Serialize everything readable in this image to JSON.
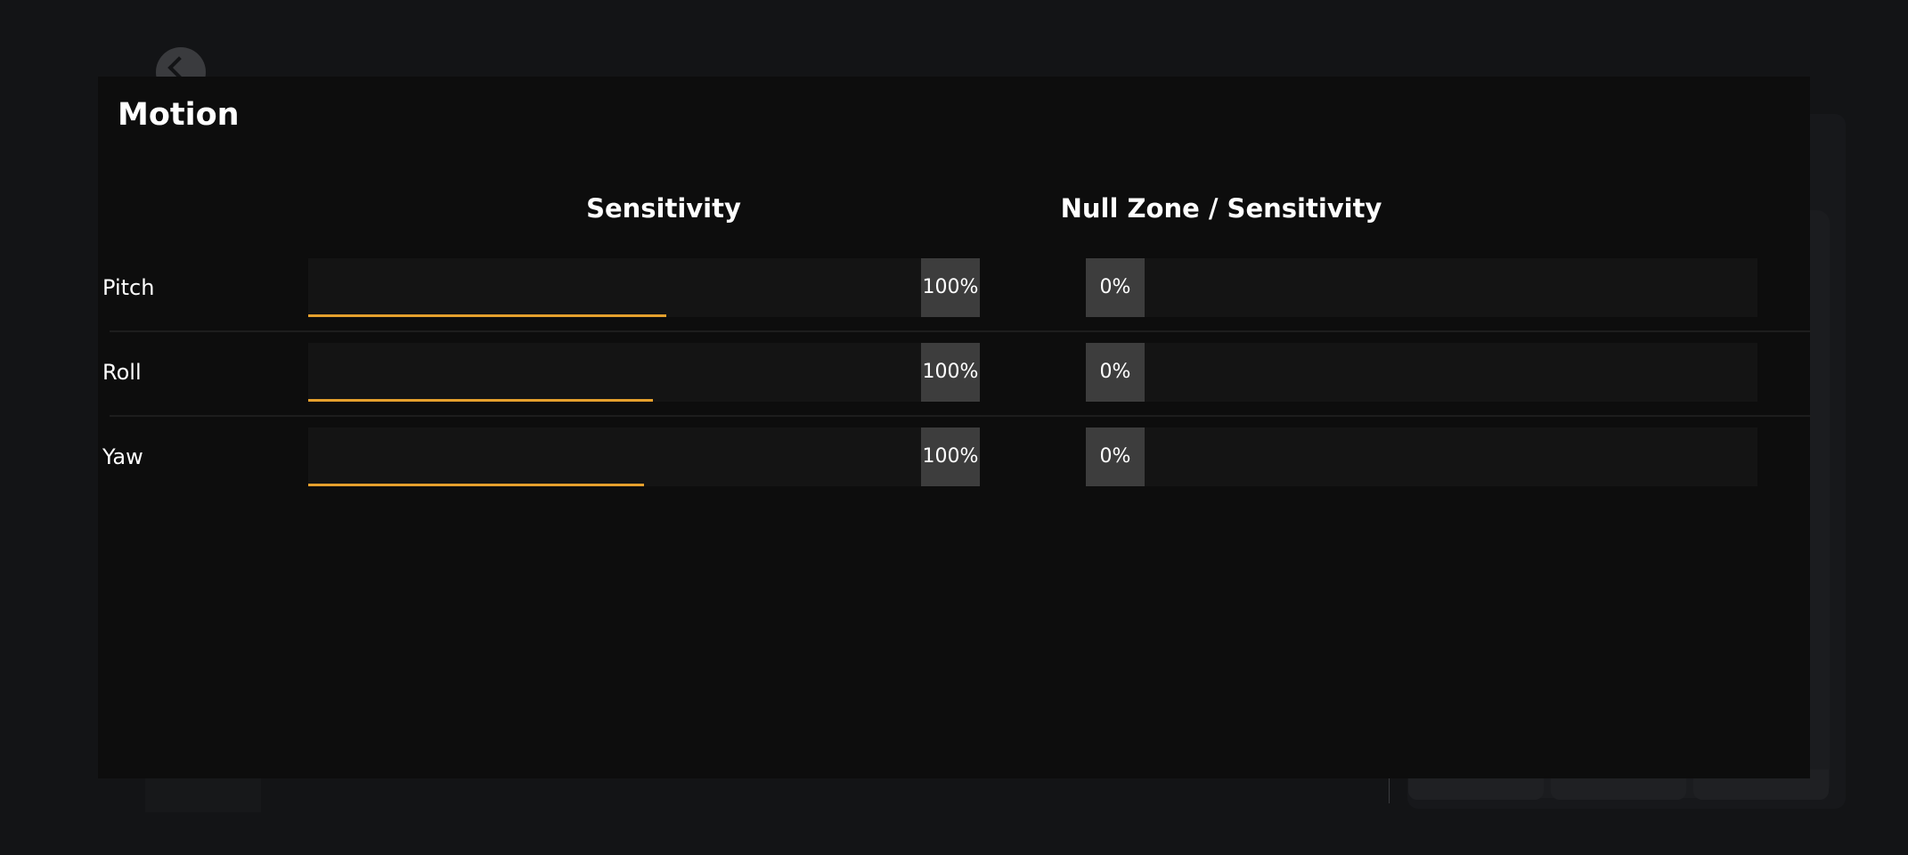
{
  "modal": {
    "title": "Motion",
    "columns": {
      "sensitivity": "Sensitivity",
      "null_zone": "Null Zone / Sensitivity"
    },
    "rows": [
      {
        "label": "Pitch",
        "sensitivity_value": "100%",
        "null_zone_value": "0%",
        "sensitivity_fill": 0.585
      },
      {
        "label": "Roll",
        "sensitivity_value": "100%",
        "null_zone_value": "0%",
        "sensitivity_fill": 0.562
      },
      {
        "label": "Yaw",
        "sensitivity_value": "100%",
        "null_zone_value": "0%",
        "sensitivity_fill": 0.548
      }
    ]
  },
  "colors": {
    "accent": "#e5a02d",
    "modal_background": "#0d0d0d",
    "value_box": "#3d3d3d"
  },
  "icons": {
    "background_back": "back-arrow-icon"
  }
}
